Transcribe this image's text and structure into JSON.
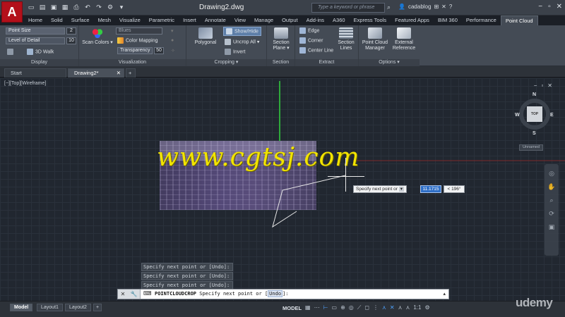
{
  "app": {
    "logo_letter": "A",
    "doc_title": "Drawing2.dwg",
    "search_placeholder": "Type a keyword or phrase",
    "username": "cadablog"
  },
  "ribbon_tabs": [
    "Home",
    "Solid",
    "Surface",
    "Mesh",
    "Visualize",
    "Parametric",
    "Insert",
    "Annotate",
    "View",
    "Manage",
    "Output",
    "Add-ins",
    "A360",
    "Express Tools",
    "Featured Apps",
    "BIM 360",
    "Performance",
    "Point Cloud"
  ],
  "active_ribbon_tab": "Point Cloud",
  "display_panel": {
    "title": "Display",
    "point_size_label": "Point Size",
    "point_size_value": "2",
    "level_of_detail_label": "Level of Detail",
    "level_of_detail_value": "10",
    "walk_label": "3D Walk"
  },
  "visualization_panel": {
    "title": "Visualization",
    "scan_colors_label": "Scan Colors",
    "color_scheme_value": "Blues",
    "color_mapping_label": "Color Mapping",
    "transparency_label": "Transparency",
    "transparency_value": "50"
  },
  "cropping_panel": {
    "title": "Cropping",
    "polygonal_label": "Polygonal",
    "show_hide_label": "Show/Hide",
    "uncrop_all_label": "Uncrop All",
    "invert_label": "Invert"
  },
  "section_panel": {
    "title": "Section",
    "section_plane_label": "Section Plane"
  },
  "extract_panel": {
    "title": "Extract",
    "edge_label": "Edge",
    "corner_label": "Corner",
    "center_line_label": "Center Line",
    "section_lines_label": "Section Lines"
  },
  "options_panel": {
    "title": "Options",
    "manager_label": "Point Cloud Manager",
    "external_reference_label": "External Reference"
  },
  "doc_tabs": [
    "Start",
    "Drawing2*"
  ],
  "viewport": {
    "label": "[−][Top][Wireframe]",
    "viewcube_face": "TOP",
    "compass_n": "N",
    "compass_s": "S",
    "compass_e": "E",
    "compass_w": "W",
    "wcs_label": "Unnamed"
  },
  "watermark": "www.cgtsj.com",
  "dynamic_input": {
    "prompt": "Specify next point or",
    "length_value": "11.1715",
    "angle_value": "< 196°"
  },
  "command_history": [
    "Specify next point or [Undo]:",
    "Specify next point or [Undo]:",
    "Specify next point or [Undo]:"
  ],
  "command_line": {
    "command": "POINTCLOUDCROP",
    "prompt": "Specify next point or [",
    "option": "Undo",
    "suffix": "]:"
  },
  "layout_tabs": [
    "Model",
    "Layout1",
    "Layout2"
  ],
  "status": {
    "model_label": "MODEL",
    "scale": "1:1"
  },
  "brand_watermark": "udemy",
  "colors": {
    "app_logo": "#b3101b",
    "ribbon_bg": "#444b55",
    "viewport_bg": "#212730",
    "watermark": "#f2e400",
    "accent_blue": "#2f6fc7"
  }
}
